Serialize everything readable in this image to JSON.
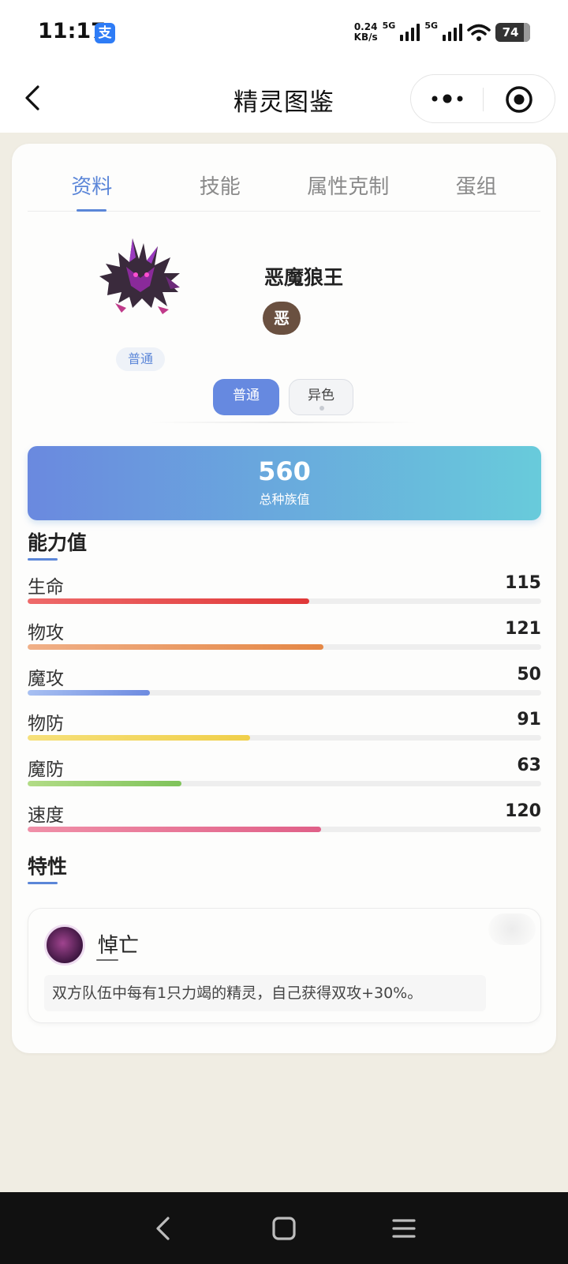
{
  "status_bar": {
    "time": "11:17",
    "app_icon_glyph": "支",
    "net_speed_value": "0.24",
    "net_speed_unit": "KB/s",
    "network_1": "5G",
    "network_2": "5G",
    "battery": "74"
  },
  "nav": {
    "title": "精灵图鉴"
  },
  "tabs": [
    {
      "label": "资料",
      "active": true
    },
    {
      "label": "技能",
      "active": false
    },
    {
      "label": "属性克制",
      "active": false
    },
    {
      "label": "蛋组",
      "active": false
    }
  ],
  "pet": {
    "name": "恶魔狼王",
    "type": "恶",
    "form_tag": "普通",
    "variant_normal": "普通",
    "variant_shiny": "异色"
  },
  "total": {
    "value": "560",
    "label": "总种族值"
  },
  "stats_section": {
    "title": "能力值",
    "max": 210,
    "items": [
      {
        "name": "生命",
        "value": 115,
        "color_start": "#ee6a6a",
        "color_end": "#e03838"
      },
      {
        "name": "物攻",
        "value": 121,
        "color_start": "#f0b088",
        "color_end": "#e58745"
      },
      {
        "name": "魔攻",
        "value": 50,
        "color_start": "#a8c0f2",
        "color_end": "#6d8be0"
      },
      {
        "name": "物防",
        "value": 91,
        "color_start": "#f6e07a",
        "color_end": "#f0cf4a"
      },
      {
        "name": "魔防",
        "value": 63,
        "color_start": "#b2dc86",
        "color_end": "#7fc35a"
      },
      {
        "name": "速度",
        "value": 120,
        "color_start": "#f090a8",
        "color_end": "#e06088"
      }
    ]
  },
  "trait_section": {
    "title": "特性",
    "name": "悼亡",
    "description": "双方队伍中每有1只力竭的精灵，自己获得双攻+30%。"
  }
}
